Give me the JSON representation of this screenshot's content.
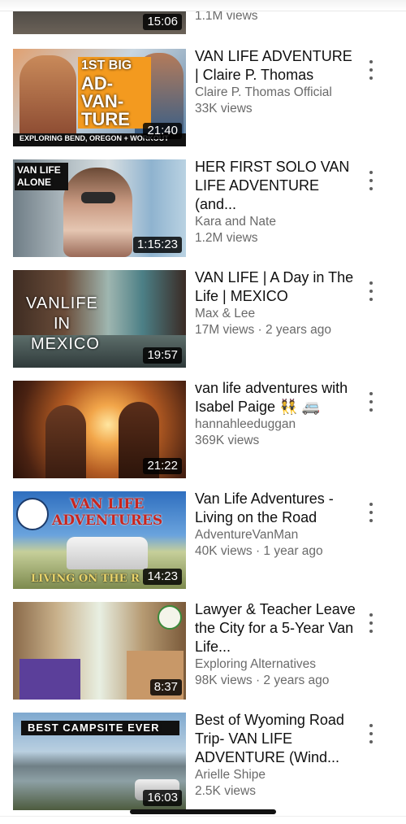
{
  "colors": {
    "background": "#ffffff",
    "title": "#0f0f0f",
    "secondary": "#6a6a6a"
  },
  "partial_item": {
    "duration": "15:06",
    "meta": "1.1M views"
  },
  "videos": [
    {
      "title": "VAN LIFE ADVENTURE | Claire P. Thomas",
      "channel": "Claire P. Thomas Official",
      "meta": "33K views",
      "duration": "21:40",
      "thumb_text": {
        "badge": "1ST BIG",
        "big1": "AD-",
        "big2": "VAN-",
        "big3": "TURE",
        "footer": "EXPLORING BEND, OREGON + WORKOUT"
      }
    },
    {
      "title": "HER FIRST SOLO VAN LIFE ADVENTURE (and...",
      "channel": "Kara and Nate",
      "meta": "1.2M views",
      "duration": "1:15:23",
      "thumb_text": {
        "line1": "VAN LIFE",
        "line2": "ALONE"
      }
    },
    {
      "title": "VAN LIFE | A Day in The Life | MEXICO",
      "channel": "Max & Lee",
      "meta": "17M views · 2 years ago",
      "duration": "19:57",
      "thumb_text": {
        "line1": "VANLIFE",
        "line2": "IN",
        "line3": "MEXICO"
      }
    },
    {
      "title": "van life adventures with Isabel Paige 👯 🚐",
      "channel": "hannahleeduggan",
      "meta": "369K views",
      "duration": "21:22"
    },
    {
      "title": "Van Life Adventures - Living on the Road",
      "channel": "AdventureVanMan",
      "meta": "40K views · 1 year ago",
      "duration": "14:23",
      "thumb_text": {
        "line1": "VAN LIFE",
        "line2": "ADVENTURES",
        "footer": "LIVING ON THE R"
      }
    },
    {
      "title": "Lawyer & Teacher Leave the City for a 5-Year Van Life...",
      "channel": "Exploring Alternatives",
      "meta": "98K views · 2 years ago",
      "duration": "8:37"
    },
    {
      "title": "Best of Wyoming Road Trip- VAN LIFE ADVENTURE (Wind...",
      "channel": "Arielle Shipe",
      "meta": "2.5K views",
      "duration": "16:03",
      "thumb_text": {
        "banner": "BEST CAMPSITE EVER"
      }
    }
  ]
}
